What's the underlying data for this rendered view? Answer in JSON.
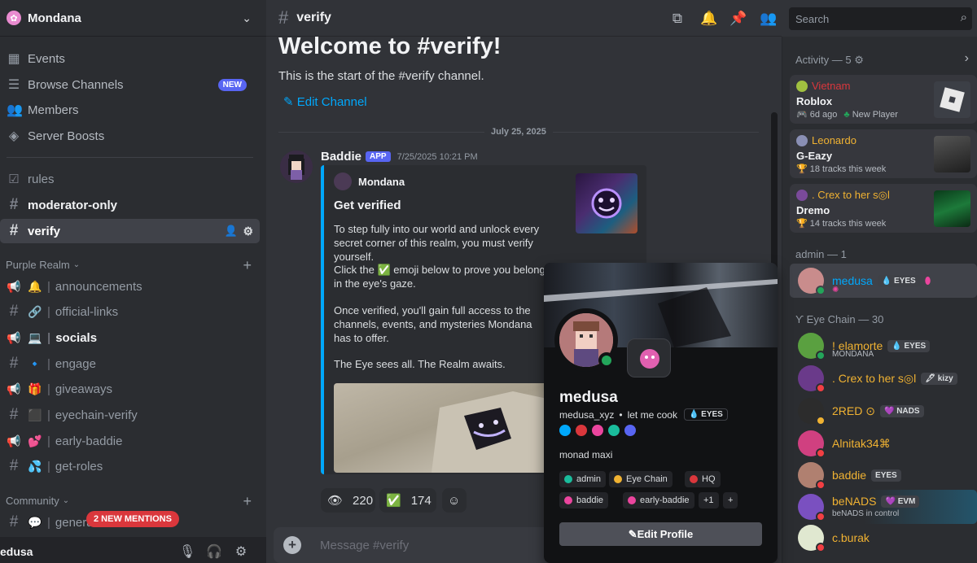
{
  "server": {
    "name": "Mondana"
  },
  "sidebar": {
    "top_items": [
      {
        "label": "Events",
        "icon": "calendar-icon"
      },
      {
        "label": "Browse Channels",
        "icon": "browse-icon",
        "badge": "NEW"
      },
      {
        "label": "Members",
        "icon": "members-icon"
      },
      {
        "label": "Server Boosts",
        "icon": "boost-icon"
      }
    ],
    "channels": [
      {
        "label": "rules",
        "icon": "rules-icon"
      },
      {
        "label": "moderator-only",
        "icon": "hash-icon"
      },
      {
        "label": "verify",
        "icon": "hash-icon"
      }
    ],
    "category1": "Purple Realm",
    "category1_channels": [
      {
        "emoji": "🔔",
        "label": "announcements"
      },
      {
        "emoji": "🔗",
        "label": "official-links"
      },
      {
        "emoji": "💻",
        "label": "socials"
      },
      {
        "emoji": "🔹",
        "label": "engage"
      },
      {
        "emoji": "🎁",
        "label": "giveaways"
      },
      {
        "emoji": "⬛",
        "label": "eyechain-verify"
      },
      {
        "emoji": "💕",
        "label": "early-baddie"
      },
      {
        "emoji": "💦",
        "label": "get-roles"
      }
    ],
    "category2": "Community",
    "category2_channels": [
      {
        "emoji": "💬",
        "label": "genera"
      }
    ],
    "mentions_pill": "2 NEW MENTIONS",
    "user_name": "edusa"
  },
  "chat": {
    "channel": "verify",
    "welcome": "Welcome to #verify!",
    "start_text": "This is the start of the #verify channel.",
    "edit_channel": "Edit Channel",
    "date": "July 25, 2025",
    "message": {
      "author": "Baddie",
      "app_tag": "APP",
      "timestamp": "7/25/2025 10:21 PM",
      "embed_author": "Mondana",
      "embed_title": "Get verified",
      "p1": "To step fully into our world and unlock every secret corner of this realm, you must verify yourself.",
      "p2": "Click the ✅ emoji below to prove you belong in the eye's gaze.",
      "p3": "Once verified, you'll gain full access to the channels, events, and mysteries Mondana has to offer.",
      "p4": "The Eye sees all. The Realm awaits."
    },
    "reactions": [
      {
        "emoji": "👁",
        "count": "220"
      },
      {
        "emoji": "✅",
        "count": "174"
      }
    ],
    "composer_placeholder": "Message #verify"
  },
  "header": {
    "search_placeholder": "Search"
  },
  "activity": {
    "heading": "Activity — 5",
    "cards": [
      {
        "user": "Vietnam",
        "user_color": "#da373c",
        "title": "Roblox",
        "detail": "6d ago",
        "extra": "New Player"
      },
      {
        "user": "Leonardo",
        "user_color": "#f0b232",
        "title": "G-Eazy",
        "detail": "18 tracks this week"
      },
      {
        "user": ". Crex to her s◎l",
        "user_color": "#f0b232",
        "title": "Dremo",
        "detail": "14 tracks this week"
      }
    ]
  },
  "members": {
    "admin_heading": "admin — 1",
    "admin": [
      {
        "name": "medusa",
        "color": "#00a8fc",
        "tag": "EYES"
      }
    ],
    "eyechain_heading": "Eye Chain — 30",
    "list": [
      {
        "name": "! elamorte",
        "color": "#f0b232",
        "tag": "EYES",
        "sub": "MONDANA"
      },
      {
        "name": ". Crex to her s◎l",
        "color": "#f0b232",
        "tag": "kizy"
      },
      {
        "name": "2RED ⊙",
        "color": "#f0b232",
        "tag": "NADS"
      },
      {
        "name": "Alnitak34⌘",
        "color": "#f0b232"
      },
      {
        "name": "baddie",
        "color": "#f0b232",
        "tag": "EYES"
      },
      {
        "name": "beNADS",
        "color": "#f0b232",
        "tag": "EVM",
        "sub": "beNADS in control"
      },
      {
        "name": "c.burak",
        "color": "#f0b232"
      }
    ]
  },
  "popout": {
    "name": "medusa",
    "handle": "medusa_xyz",
    "status": "let me cook",
    "tag": "EYES",
    "bio": "monad maxi",
    "roles": [
      {
        "label": "admin",
        "color": "#1abc9c"
      },
      {
        "label": "Eye Chain",
        "color": "#f0b232"
      },
      {
        "label": "HQ",
        "color": "#da373c"
      },
      {
        "label": "baddie",
        "color": "#eb459e"
      },
      {
        "label": "early-baddie",
        "color": "#eb459e"
      },
      {
        "label": "+1",
        "color": ""
      }
    ],
    "edit_profile": "Edit Profile"
  }
}
